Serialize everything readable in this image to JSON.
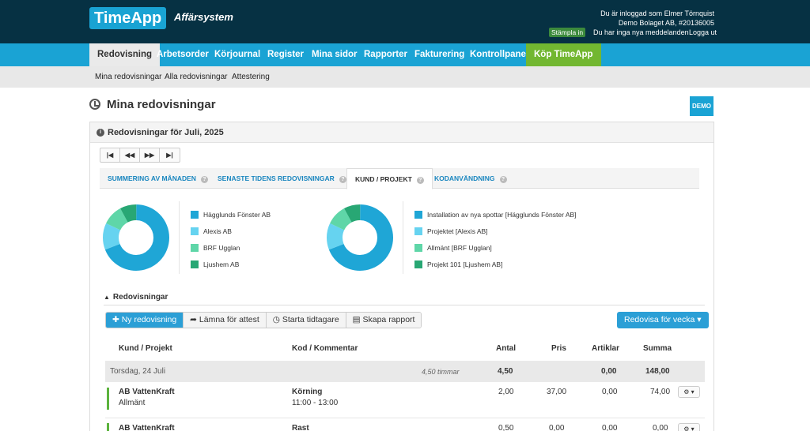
{
  "header": {
    "logo": "TimeApp",
    "subtitle": "Affärsystem",
    "logged_in": "Du är inloggad som Elmer Törnquist",
    "company": "Demo Bolaget AB, #20136005",
    "stampla": "Stämpla in",
    "messages": "Du har inga nya meddelanden",
    "logout": "Logga ut"
  },
  "nav": {
    "items": [
      "Redovisning",
      "Arbetsorder",
      "Körjournal",
      "Register",
      "Mina sidor",
      "Rapporter",
      "Fakturering",
      "Kontrollpanel",
      "Köp TimeApp"
    ]
  },
  "subnav": {
    "items": [
      "Mina redovisningar",
      "Alla redovisningar",
      "Attestering"
    ]
  },
  "page": {
    "title": "Mina redovisningar",
    "demo": "DEMO"
  },
  "panel": {
    "title": "Redovisningar för Juli, 2025",
    "tabs": [
      "SUMMERING AV MÅNADEN",
      "SENASTE TIDENS REDOVISNINGAR",
      "KUND / PROJEKT",
      "KODANVÄNDNING"
    ]
  },
  "charts": {
    "customers": {
      "items": [
        {
          "label": "Hägglunds Fönster AB",
          "color": "#1fa6d6",
          "value": 0.69
        },
        {
          "label": "Alexis AB",
          "color": "#66d3f0",
          "value": 0.13
        },
        {
          "label": "BRF Ugglan",
          "color": "#5fd6a8",
          "value": 0.1
        },
        {
          "label": "Ljushem AB",
          "color": "#28a774",
          "value": 0.08
        }
      ]
    },
    "projects": {
      "items": [
        {
          "label": "Installation av nya spottar [Hägglunds Fönster AB]",
          "color": "#1fa6d6",
          "value": 0.69
        },
        {
          "label": "Projektet [Alexis AB]",
          "color": "#66d3f0",
          "value": 0.13
        },
        {
          "label": "Allmänt [BRF Ugglan]",
          "color": "#5fd6a8",
          "value": 0.1
        },
        {
          "label": "Projekt 101 [Ljushem AB]",
          "color": "#28a774",
          "value": 0.08
        }
      ]
    }
  },
  "section": {
    "title": "Redovisningar"
  },
  "toolbar": {
    "new": "Ny redovisning",
    "submit": "Lämna för attest",
    "timer": "Starta tidtagare",
    "report": "Skapa rapport",
    "redovisa": "Redovisa för vecka"
  },
  "table": {
    "headers": {
      "customer": "Kund / Projekt",
      "code": "Kod / Kommentar",
      "antal": "Antal",
      "pris": "Pris",
      "artiklar": "Artiklar",
      "summa": "Summa"
    },
    "day": {
      "date": "Torsdag, 24 Juli",
      "hours": "4,50 timmar",
      "antal": "4,50",
      "artiklar": "0,00",
      "summa": "148,00"
    },
    "rows": [
      {
        "customer": "AB VattenKraft",
        "project": "Allmänt",
        "code": "Körning",
        "time": "11:00 - 13:00",
        "antal": "2,00",
        "pris": "37,00",
        "artiklar": "0,00",
        "summa": "74,00"
      },
      {
        "customer": "AB VattenKraft",
        "project": "",
        "code": "Rast",
        "time": "",
        "antal": "0,50",
        "pris": "0,00",
        "artiklar": "0,00",
        "summa": "0,00"
      }
    ]
  }
}
